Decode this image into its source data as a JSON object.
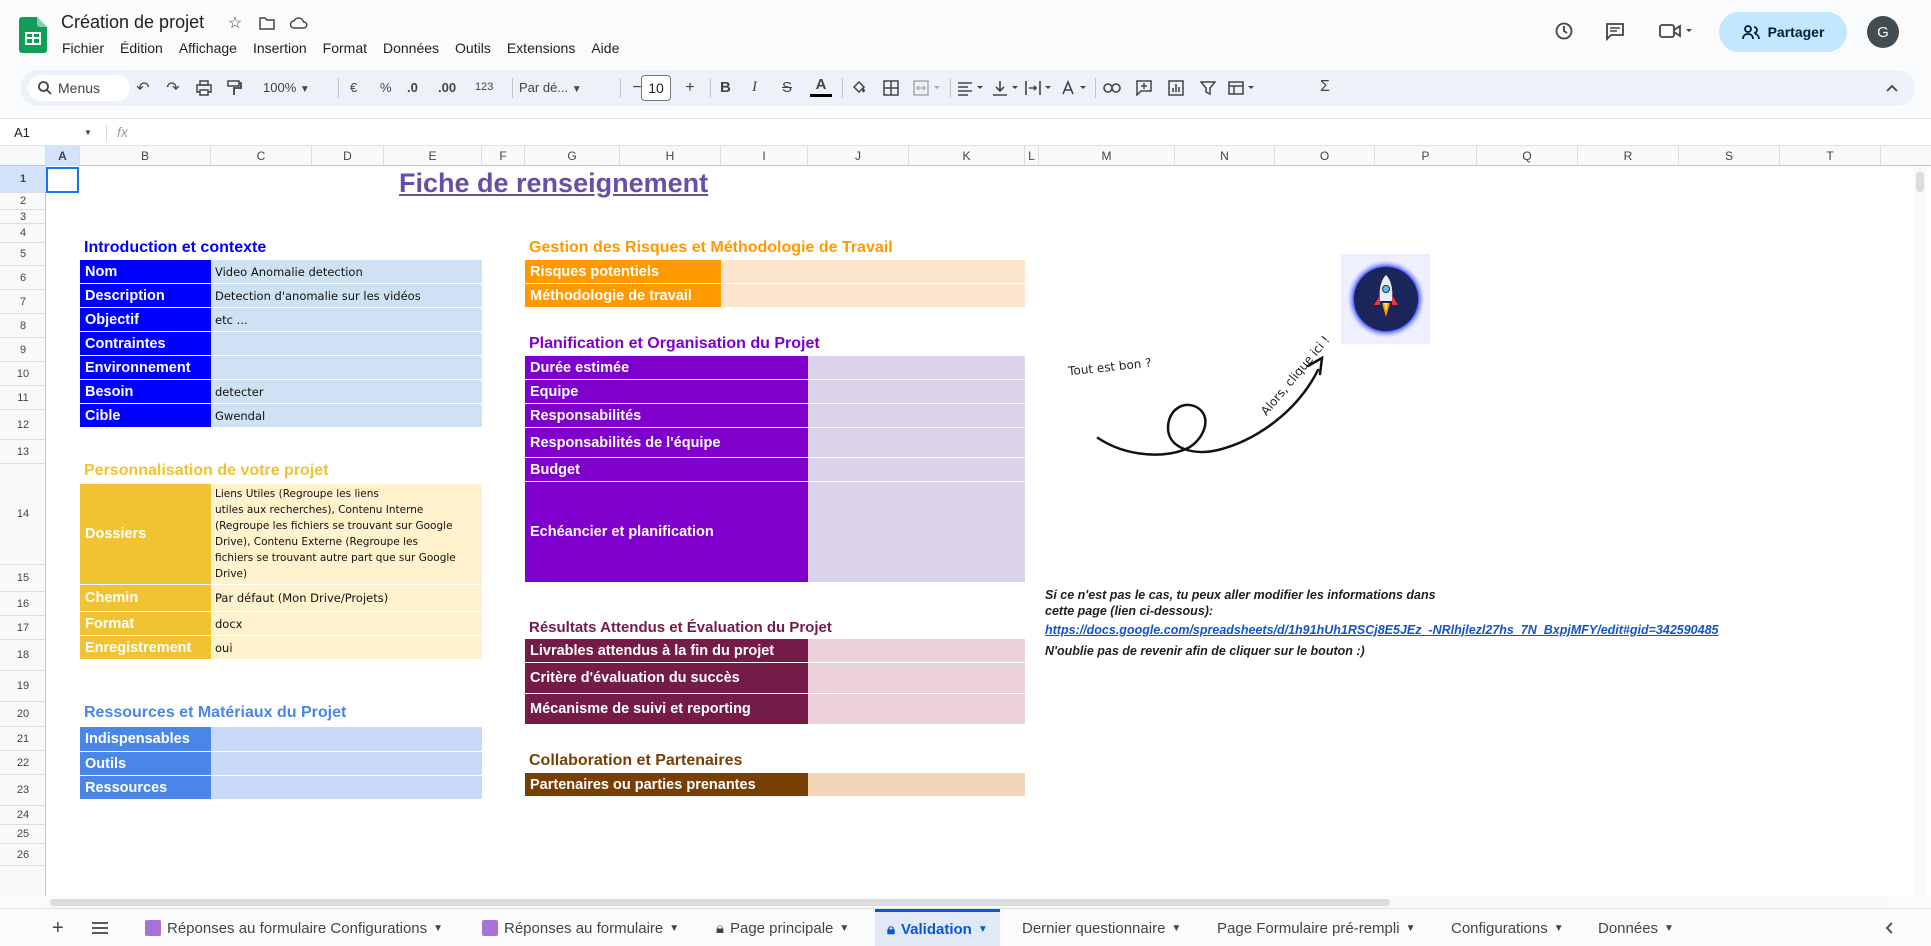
{
  "app": {
    "title": "Création de projet",
    "menu": [
      "Fichier",
      "Édition",
      "Affichage",
      "Insertion",
      "Format",
      "Données",
      "Outils",
      "Extensions",
      "Aide"
    ],
    "share_label": "Partager",
    "avatar_initial": "G"
  },
  "toolbar": {
    "menus_label": "Menus",
    "zoom": "100%",
    "currency": "€",
    "percent": "%",
    "dec_decrease": ".0",
    "dec_increase": ".00",
    "number_format": "123",
    "font": "Par dé...",
    "font_size": "10",
    "bold": "B",
    "italic": "I",
    "strike": "S",
    "text_color": "A",
    "sum": "Σ"
  },
  "formula": {
    "name_box": "A1",
    "fx": "fx"
  },
  "columns": [
    "A",
    "B",
    "C",
    "D",
    "E",
    "F",
    "G",
    "H",
    "I",
    "J",
    "K",
    "L",
    "M",
    "N",
    "O",
    "P",
    "Q",
    "R",
    "S",
    "T"
  ],
  "rows": [
    "1",
    "2",
    "3",
    "4",
    "5",
    "6",
    "7",
    "8",
    "9",
    "10",
    "11",
    "12",
    "13",
    "14",
    "15",
    "16",
    "17",
    "18",
    "19",
    "20",
    "21",
    "22",
    "23",
    "24",
    "25",
    "26"
  ],
  "sheet": {
    "title": "Fiche de renseignement",
    "intro": {
      "heading": "Introduction et contexte",
      "items": [
        {
          "label": "Nom",
          "value": "Video Anomalie detection"
        },
        {
          "label": "Description",
          "value": "Detection d'anomalie sur les vidéos"
        },
        {
          "label": "Objectif",
          "value": "etc ..."
        },
        {
          "label": "Contraintes",
          "value": ""
        },
        {
          "label": "Environnement",
          "value": ""
        },
        {
          "label": "Besoin",
          "value": "detecter"
        },
        {
          "label": "Cible",
          "value": "Gwendal"
        }
      ]
    },
    "perso": {
      "heading": "Personnalisation de votre projet",
      "items": [
        {
          "label": "Dossiers",
          "value": [
            "Liens Utiles            (Regroupe les liens",
            "utiles aux recherches), Contenu Interne",
            "(Regroupe les fichiers se trouvant sur Google",
            "Drive), Contenu Externe       (Regroupe les",
            "fichiers se trouvant autre part que sur Google",
            "Drive)"
          ]
        },
        {
          "label": "Chemin",
          "value": "Par défaut (Mon Drive/Projets)"
        },
        {
          "label": "Format",
          "value": "docx"
        },
        {
          "label": "Enregistrement",
          "value": "oui"
        }
      ]
    },
    "ressources": {
      "heading": "Ressources et Matériaux du Projet",
      "items": [
        {
          "label": "Indispensables"
        },
        {
          "label": "Outils"
        },
        {
          "label": "Ressources"
        }
      ]
    },
    "risques": {
      "heading": "Gestion des Risques et Méthodologie de Travail",
      "items": [
        {
          "label": "Risques potentiels"
        },
        {
          "label": "Méthodologie de travail"
        }
      ]
    },
    "planif": {
      "heading": "Planification et Organisation du Projet",
      "items": [
        {
          "label": "Durée estimée"
        },
        {
          "label": "Equipe"
        },
        {
          "label": "Responsabilités"
        },
        {
          "label": "Responsabilités de l'équipe"
        },
        {
          "label": "Budget"
        },
        {
          "label": "Echéancier et planification"
        }
      ]
    },
    "resultats": {
      "heading": "Résultats Attendus et Évaluation du Projet",
      "items": [
        {
          "label": "Livrables attendus à la fin du projet"
        },
        {
          "label": "Critère d'évaluation du succès"
        },
        {
          "label": "Mécanisme de suivi et reporting"
        }
      ]
    },
    "collab": {
      "heading": "Collaboration et Partenaires",
      "items": [
        {
          "label": "Partenaires ou parties prenantes"
        }
      ]
    },
    "annot": {
      "tout_bon": "Tout est bon ?",
      "clique": "Alors, clique ici !"
    },
    "note": {
      "line1": "Si ce n'est pas le cas, tu peux aller modifier les informations dans",
      "line2": "cette page (lien ci-dessous):",
      "link": "https://docs.google.com/spreadsheets/d/1h91hUh1RSCj8E5JEz_-NRlhjlezl27hs_7N_BxpjMFY/edit#gid=342590485",
      "line3": "N'oublie pas de revenir afin de cliquer sur le bouton :)"
    }
  },
  "tabs": [
    {
      "label": "Réponses au formulaire Configurations",
      "icon": "form-icon"
    },
    {
      "label": "Réponses au formulaire",
      "icon": "form-icon"
    },
    {
      "label": "Page principale",
      "icon": "lock-icon"
    },
    {
      "label": "Validation",
      "icon": "lock-icon"
    },
    {
      "label": "Dernier questionnaire"
    },
    {
      "label": "Page Formulaire pré-rempli"
    },
    {
      "label": "Configurations"
    },
    {
      "label": "Données"
    }
  ],
  "colors": {
    "blue_label": "#0000ff",
    "blue_val": "#cfe2f3",
    "yellow_label": "#f1c232",
    "yellow_val": "#fff2cc",
    "lightblue_label": "#4a86e8",
    "lightblue_val": "#c9daf8",
    "orange_label": "#ff9900",
    "orange_val": "#fce5cd",
    "purple_label": "#7f00cc",
    "purple_val": "#d9d2e9",
    "maroon_label": "#741b47",
    "maroon_val": "#ead1dc",
    "brown_label": "#783f04",
    "brown_val": "#f3d6b8"
  }
}
